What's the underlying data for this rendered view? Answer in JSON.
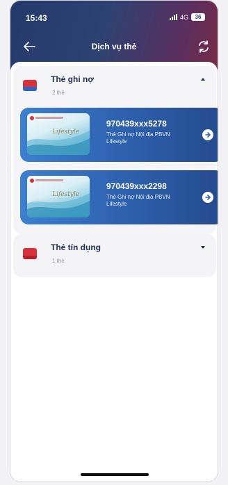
{
  "status_bar": {
    "time": "15:43",
    "network": "4G",
    "battery": "36"
  },
  "header": {
    "title": "Dịch vụ thẻ"
  },
  "debit_section": {
    "title": "Thẻ ghi nợ",
    "count": "2 thẻ",
    "cards": [
      {
        "number": "970439xxx5278",
        "desc": "Thẻ Ghi nợ Nội địa PBVN Lifestyle",
        "script": "Lifestyle"
      },
      {
        "number": "970439xxx2298",
        "desc": "Thẻ Ghi nợ Nội địa PBVN Lifestyle",
        "script": "Lifestyle"
      }
    ]
  },
  "credit_section": {
    "title": "Thẻ tín dụng",
    "count": "1 thẻ"
  },
  "colors": {
    "header_start": "#243a6a",
    "header_end": "#7a2a45",
    "card_blue": "#2f64b2",
    "brand_red": "#d9313c"
  }
}
